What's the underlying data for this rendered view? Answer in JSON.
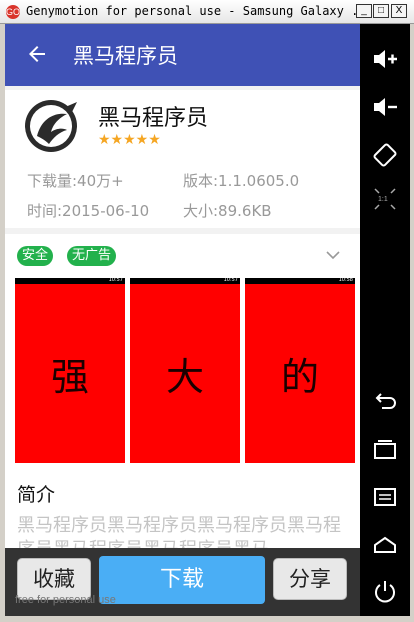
{
  "window": {
    "title": "Genymotion for personal use - Samsung Galaxy ...",
    "icon_label": "GO",
    "minimize_label": "_",
    "maximize_label": "□",
    "close_label": "X"
  },
  "appbar": {
    "title": "黑马程序员"
  },
  "app": {
    "name": "黑马程序员",
    "stars": "★★★★★",
    "downloads": "下载量:40万+",
    "version": "版本:1.1.0605.0",
    "time": "时间:2015-06-10",
    "size": "大小:89.6KB"
  },
  "badges": [
    "安全",
    "无广告"
  ],
  "screenshots": [
    {
      "char": "强",
      "status": "10:57"
    },
    {
      "char": "大",
      "status": "10:57"
    },
    {
      "char": "的",
      "status": "10:58"
    }
  ],
  "intro": {
    "title": "简介",
    "text": "黑马程序员黑马程序员黑马程序员黑马程序员黑马程序员黑马程序员黑马"
  },
  "bottom": {
    "favorite": "收藏",
    "download": "下载",
    "share": "分享"
  },
  "watermark": "free for personal use",
  "nav": {
    "ratio_label": "1:1"
  },
  "colors": {
    "primary": "#3f51b5",
    "badge": "#22b14c",
    "download": "#4aaef5",
    "screenshot": "#ff0000"
  }
}
